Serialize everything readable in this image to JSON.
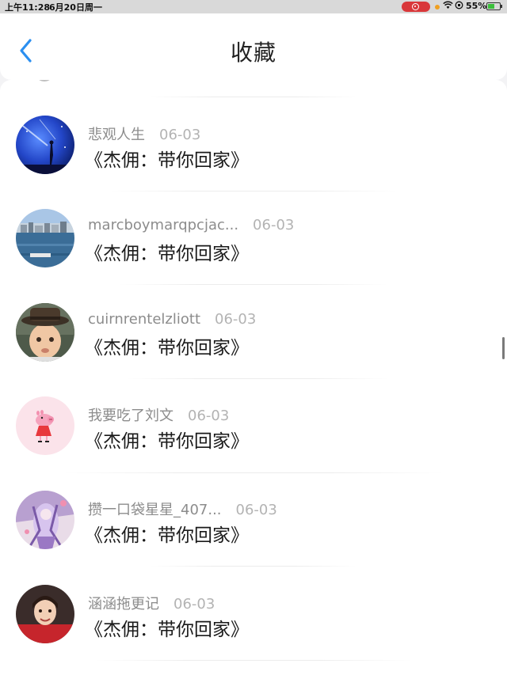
{
  "status_bar": {
    "time": "上午11:28",
    "date": "6月20日周一",
    "battery": "55%",
    "battery_level": 0.55
  },
  "header": {
    "title": "收藏",
    "back_icon": "chevron-left-icon",
    "accent_color": "#2b8ff0"
  },
  "favorites": [
    {
      "user": "悲观人生",
      "date": "06-03",
      "title": "《杰佣：带你回家》",
      "avatar": "night-sky-figure"
    },
    {
      "user": "marcboymarqpcjac...",
      "date": "06-03",
      "title": "《杰佣：带你回家》",
      "avatar": "harbor-town"
    },
    {
      "user": "cuirnrentelzliott",
      "date": "06-03",
      "title": "《杰佣：带你回家》",
      "avatar": "boy-with-hat"
    },
    {
      "user": "我要吃了刘文",
      "date": "06-03",
      "title": "《杰佣：带你回家》",
      "avatar": "peppa-pig"
    },
    {
      "user": "攒一口袋星星_407...",
      "date": "06-03",
      "title": "《杰佣：带你回家》",
      "avatar": "anime-art"
    },
    {
      "user": "涵涵拖更记",
      "date": "06-03",
      "title": "《杰佣：带你回家》",
      "avatar": "girl-photo"
    }
  ]
}
